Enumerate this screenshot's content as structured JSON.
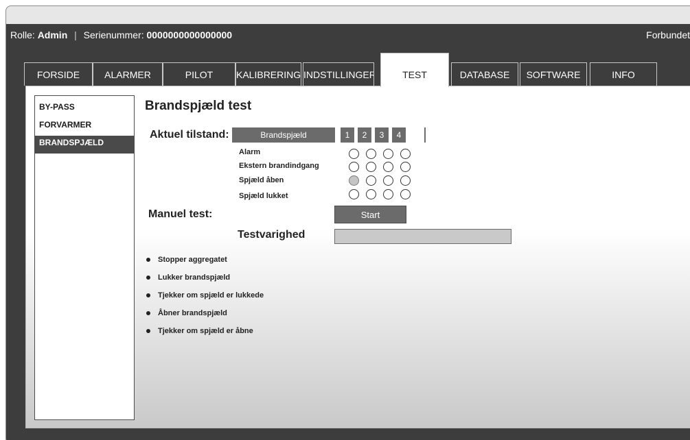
{
  "status_bar": {
    "role_label": "Rolle:",
    "role_value": "Admin",
    "divider": "|",
    "serial_label": "Serienummer:",
    "serial_value": "0000000000000000",
    "connection": "Forbundet"
  },
  "tabs": [
    {
      "label": "FORSIDE"
    },
    {
      "label": "ALARMER"
    },
    {
      "label": "PILOT"
    },
    {
      "label": "KALIBRERING"
    },
    {
      "label": "INDSTILLINGER"
    },
    {
      "label": "TEST"
    },
    {
      "label": "DATABASE"
    },
    {
      "label": "SOFTWARE"
    },
    {
      "label": "INFO"
    }
  ],
  "active_tab": "TEST",
  "sidebar": {
    "items": [
      {
        "label": "BY-PASS"
      },
      {
        "label": "FORVARMER"
      },
      {
        "label": "BRANDSPJÆLD"
      }
    ],
    "active": "BRANDSPJÆLD"
  },
  "main": {
    "title": "Brandspjæld test",
    "current_state_label": "Aktuel tilstand:",
    "table": {
      "header": "Brandspjæld",
      "columns": [
        "1",
        "2",
        "3",
        "4"
      ],
      "rows": [
        {
          "label": "Alarm",
          "states": [
            false,
            false,
            false,
            false
          ]
        },
        {
          "label": "Ekstern brandindgang",
          "states": [
            false,
            false,
            false,
            false
          ]
        },
        {
          "label": "Spjæld åben",
          "states": [
            true,
            false,
            false,
            false
          ]
        },
        {
          "label": "Spjæld lukket",
          "states": [
            false,
            false,
            false,
            false
          ]
        }
      ]
    },
    "manual_test_label": "Manuel test:",
    "start_button": "Start",
    "duration_label": "Testvarighed",
    "duration_progress": 0,
    "steps": [
      "Stopper aggregatet",
      "Lukker brandspjæld",
      "Tjekker om spjæld er lukkede",
      "Åbner brandspjæld",
      "Tjekker om spjæld er åbne"
    ]
  },
  "colors": {
    "dark_bar": "#3d3d3d",
    "header_cell": "#6b6b6b",
    "active_indicator": "#c4c4c4"
  }
}
